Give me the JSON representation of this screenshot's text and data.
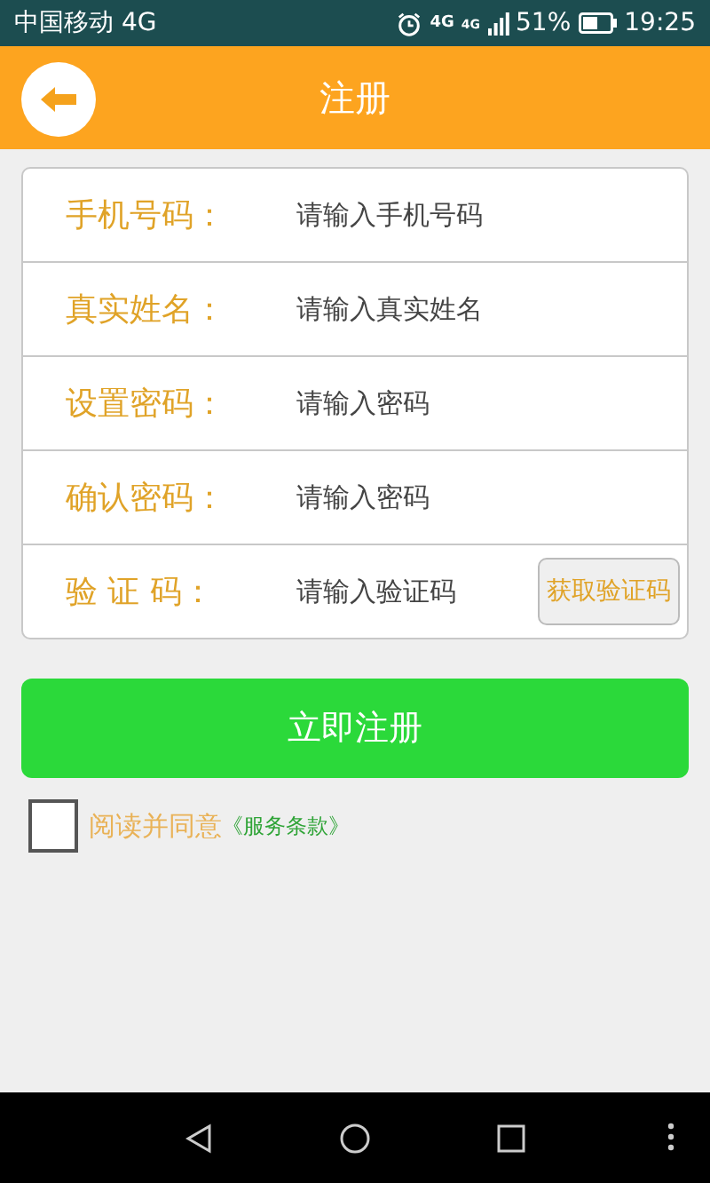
{
  "status_bar": {
    "carrier": "中国移动 4G",
    "data_badge": "4G",
    "signal_badge": "4G",
    "battery": "51%",
    "time": "19:25"
  },
  "header": {
    "title": "注册"
  },
  "form": {
    "fields": [
      {
        "kind": "text",
        "label": "手机号码：",
        "placeholder": "请输入手机号码"
      },
      {
        "kind": "text",
        "label": "真实姓名：",
        "placeholder": "请输入真实姓名"
      },
      {
        "kind": "password",
        "label": "设置密码：",
        "placeholder": "请输入密码"
      },
      {
        "kind": "password",
        "label": "确认密码：",
        "placeholder": "请输入密码"
      },
      {
        "kind": "code",
        "label": "验 证 码：",
        "placeholder": "请输入验证码",
        "button": "获取验证码"
      }
    ]
  },
  "submit_button": "立即注册",
  "agreement": {
    "checked": false,
    "text": "阅读并同意",
    "link": "《服务条款》"
  }
}
